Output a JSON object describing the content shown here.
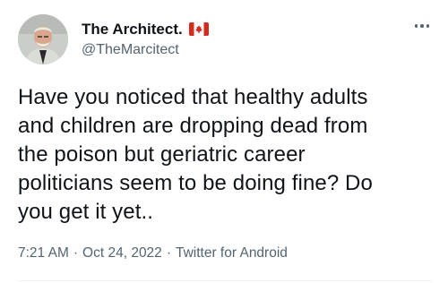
{
  "author": {
    "display_name": "The Architect.",
    "flag_icon": "canada-flag-icon",
    "handle": "@TheMarcitect",
    "avatar_icon": "avatar"
  },
  "tweet": {
    "text": "Have you noticed that healthy adults\nand children are dropping dead from\nthe poison but geriatric career\npoliticians seem to be doing fine? Do\nyou get it yet..",
    "time": "7:21 AM",
    "date": "Oct 24, 2022",
    "source": "Twitter for Android",
    "separator": "·"
  },
  "menu": {
    "icon": "more-options-icon"
  },
  "colors": {
    "text_primary": "#0f1419",
    "text_secondary": "#536471",
    "flag_red": "#d52b1e",
    "divider": "#eff3f4"
  }
}
